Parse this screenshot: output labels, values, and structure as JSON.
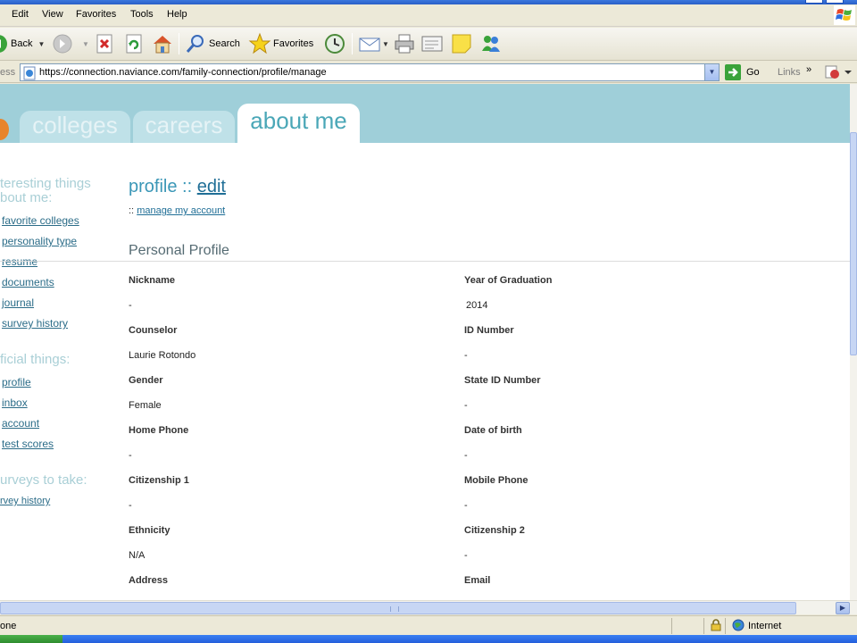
{
  "browser": {
    "menu": [
      "Edit",
      "View",
      "Favorites",
      "Tools",
      "Help"
    ],
    "toolbar": {
      "back_label": "Back",
      "search_label": "Search",
      "favorites_label": "Favorites"
    },
    "address_label": "ess",
    "url": "https://connection.naviance.com/family-connection/profile/manage",
    "go_label": "Go",
    "links_label": "Links",
    "links_chevron": "»",
    "status_text": "one",
    "zone_text": "Internet"
  },
  "nav_tabs": [
    {
      "label": "colleges",
      "active": false
    },
    {
      "label": "careers",
      "active": false
    },
    {
      "label": "about me",
      "active": true
    }
  ],
  "sidebar": {
    "sections": [
      {
        "heading": "teresting things\nbout me:",
        "links": [
          "favorite colleges",
          "personality type",
          "resume",
          "documents",
          "journal",
          "survey history"
        ]
      },
      {
        "heading": "ficial things:",
        "links": [
          "profile",
          "inbox",
          "account",
          "test scores"
        ]
      },
      {
        "heading": "urveys to take:",
        "links": [
          "rvey history"
        ]
      }
    ]
  },
  "main": {
    "title_prefix": "profile ::",
    "title_edit": "edit",
    "manage_prefix": "::",
    "manage_link": "manage my account",
    "section_title": "Personal Profile",
    "fields": [
      {
        "label": "Nickname",
        "value": "-"
      },
      {
        "label": "Year of Graduation",
        "value": "2014"
      },
      {
        "label": "Counselor",
        "value": "Laurie Rotondo"
      },
      {
        "label": "ID Number",
        "value": "-"
      },
      {
        "label": "Gender",
        "value": "Female"
      },
      {
        "label": "State ID Number",
        "value": "-"
      },
      {
        "label": "Home Phone",
        "value": "-"
      },
      {
        "label": "Date of birth",
        "value": "-"
      },
      {
        "label": "Citizenship 1",
        "value": "-"
      },
      {
        "label": "Mobile Phone",
        "value": "-"
      },
      {
        "label": "Ethnicity",
        "value": "N/A"
      },
      {
        "label": "Citizenship 2",
        "value": "-"
      },
      {
        "label": "Address",
        "value": ""
      },
      {
        "label": "Email",
        "value": ""
      }
    ]
  },
  "colors": {
    "nav_band": "#9fcfd9",
    "tab_inactive": "#bfe1e8",
    "tab_active_text": "#4aa7b7",
    "link": "#2b6c88",
    "title": "#3b97b7",
    "accent_orange": "#e8842a"
  }
}
